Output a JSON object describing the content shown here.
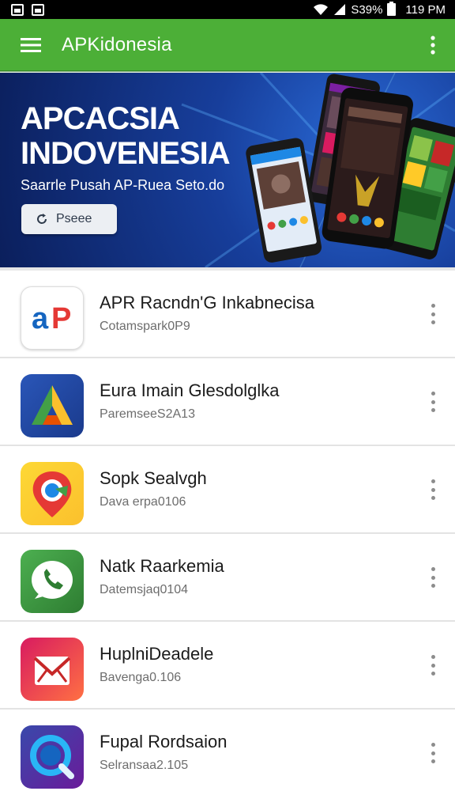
{
  "status_bar": {
    "battery_text": "S39%",
    "time": "119 PM",
    "icons": [
      "gallery-icon",
      "image-icon",
      "wifi-icon",
      "signal-icon",
      "battery-icon"
    ]
  },
  "app_bar": {
    "title": "APKidonesia",
    "color": "#4caf37"
  },
  "banner": {
    "title_line1": "APCACSIA",
    "title_line2": "INDOVENESIA",
    "subtitle": "Saarrle Pusah AP-Ruea Seto.do",
    "button_label": "Pseee"
  },
  "apps": [
    {
      "name": "APR Racndn'G Inkabnecisa",
      "meta": "Cotamspark0P9",
      "icon": "ap-logo-icon"
    },
    {
      "name": "Eura Imain Glesdolglka",
      "meta": "ParemseeS2A13",
      "icon": "triangle-logo-icon"
    },
    {
      "name": "Sopk Sealvgh",
      "meta": "Dava erpa0106",
      "icon": "map-pin-icon"
    },
    {
      "name": "Natk Raarkemia",
      "meta": "Datemsjaq0104",
      "icon": "phone-icon"
    },
    {
      "name": "HuplniDeadele",
      "meta": "Bavenga0.106",
      "icon": "mail-icon"
    },
    {
      "name": "Fupal Rordsaion",
      "meta": "Selransaa2.105",
      "icon": "search-icon"
    }
  ]
}
